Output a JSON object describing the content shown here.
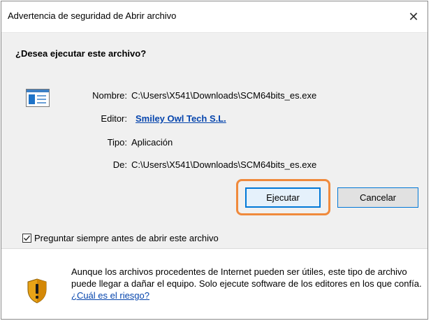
{
  "window": {
    "title": "Advertencia de seguridad de Abrir archivo",
    "close_glyph": "✕"
  },
  "prompt": {
    "question": "¿Desea ejecutar este archivo?"
  },
  "file_info": {
    "icon": "exe-file-icon",
    "name_label": "Nombre:",
    "name_value": "C:\\Users\\X541\\Downloads\\SCM64bits_es.exe",
    "publisher_label": "Editor:",
    "publisher_value": "Smiley Owl Tech S.L.",
    "type_label": "Tipo:",
    "type_value": "Aplicación",
    "from_label": "De:",
    "from_value": "C:\\Users\\X541\\Downloads\\SCM64bits_es.exe"
  },
  "buttons": {
    "run_label": "Ejecutar",
    "cancel_label": "Cancelar",
    "highlight_color": "#f08a3c"
  },
  "checkbox": {
    "label": "Preguntar siempre antes de abrir este archivo",
    "checked": true
  },
  "footer": {
    "icon": "security-shield-icon",
    "text": "Aunque los archivos procedentes de Internet pueden ser útiles, este tipo de archivo  puede llegar a dañar el equipo. Solo ejecute software de los editores en los que confía. ",
    "link": "¿Cuál es el riesgo?"
  }
}
